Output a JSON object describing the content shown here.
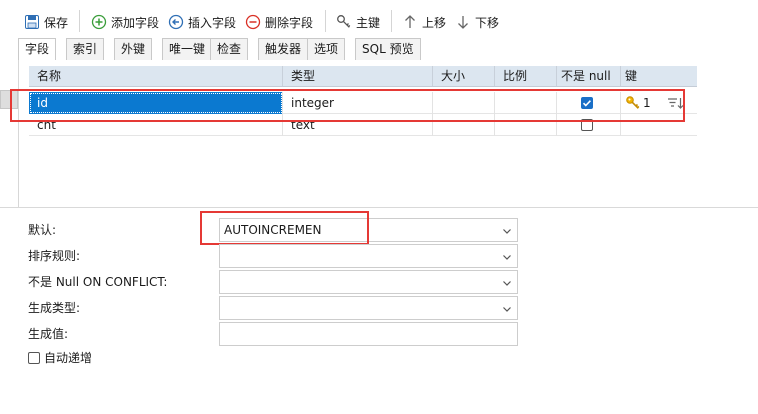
{
  "toolbar": {
    "save": "保存",
    "add_field": "添加字段",
    "insert_field": "插入字段",
    "delete_field": "删除字段",
    "primary_key": "主键",
    "move_up": "上移",
    "move_down": "下移"
  },
  "tabs": [
    {
      "label": "字段",
      "active": true
    },
    {
      "label": "索引",
      "active": false
    },
    {
      "label": "外键",
      "active": false
    },
    {
      "label": "唯一键",
      "active": false
    },
    {
      "label": "检查",
      "active": false
    },
    {
      "label": "触发器",
      "active": false
    },
    {
      "label": "选项",
      "active": false
    },
    {
      "label": "SQL 预览",
      "active": false
    }
  ],
  "grid": {
    "columns": [
      "名称",
      "类型",
      "大小",
      "比例",
      "不是 null",
      "键"
    ],
    "rows": [
      {
        "name": "id",
        "type": "integer",
        "size": "",
        "scale": "",
        "not_null": true,
        "key": "1"
      },
      {
        "name": "cnt",
        "type": "text",
        "size": "",
        "scale": "",
        "not_null": false,
        "key": ""
      }
    ]
  },
  "properties": {
    "default_label": "默认:",
    "default_value": "AUTOINCREMEN",
    "collation_label": "排序规则:",
    "collation_value": "",
    "conflict_label": "不是 Null ON CONFLICT:",
    "conflict_value": "",
    "gen_type_label": "生成类型:",
    "gen_type_value": "",
    "gen_value_label": "生成值:",
    "gen_value_value": "",
    "autoinc_label": "自动递增",
    "autoinc_checked": false
  },
  "colors": {
    "selection": "#0b79d0",
    "header_bg": "#dce6f0",
    "highlight_box": "#e53935",
    "key_icon": "#e0a400"
  }
}
